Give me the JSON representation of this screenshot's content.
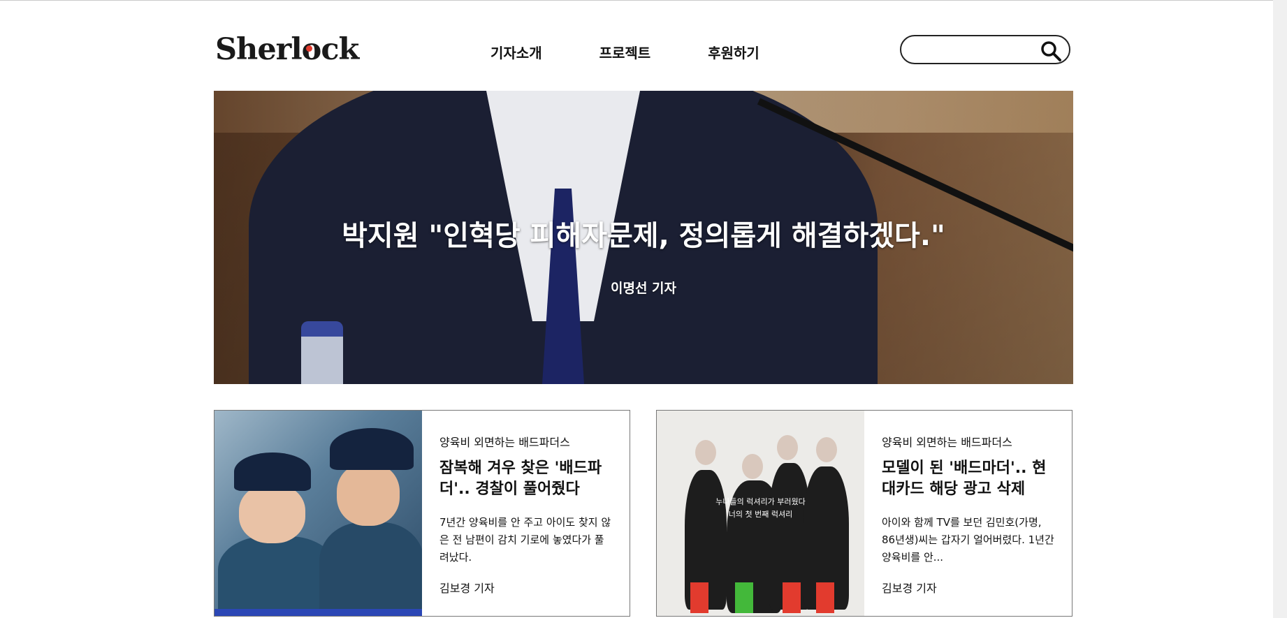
{
  "site": {
    "logo": "Sherlock",
    "logo_parts": {
      "before": "Sherl",
      "o": "o",
      "after": "ck"
    }
  },
  "nav": {
    "items": [
      {
        "label": "기자소개"
      },
      {
        "label": "프로젝트"
      },
      {
        "label": "후원하기"
      }
    ]
  },
  "search": {
    "placeholder": "",
    "value": "",
    "icon": "search-icon"
  },
  "hero": {
    "title": "박지원 \"인혁당 피해자문제, 정의롭게 해결하겠다.\"",
    "author": "이명선 기자"
  },
  "articles": [
    {
      "category": "양육비 외면하는 배드파더스",
      "title": "잠복해 겨우 찾은 '배드파더'.. 경찰이 풀어줬다",
      "excerpt": "7년간 양육비를 안 주고 아이도 찾지 않은 전 남편이 감치 기로에 놓였다가 풀려났다.",
      "author": "김보경 기자"
    },
    {
      "category": "양육비 외면하는 배드파더스",
      "title": "모델이 된 '배드마더'.. 현대카드 해당 광고 삭제",
      "excerpt": "아이와 함께 TV를 보던 김민호(가명, 86년생)씨는 갑자기 얼어버렸다. 1년간 양육비를 안...",
      "author": "김보경 기자",
      "thumb_text": [
        "누나들의 럭셔리가 부러웠다",
        "너의 첫 번째 럭셔리"
      ]
    }
  ],
  "colors": {
    "logo_accent": "#e23b2e",
    "text": "#111111",
    "card_border": "#777777"
  }
}
